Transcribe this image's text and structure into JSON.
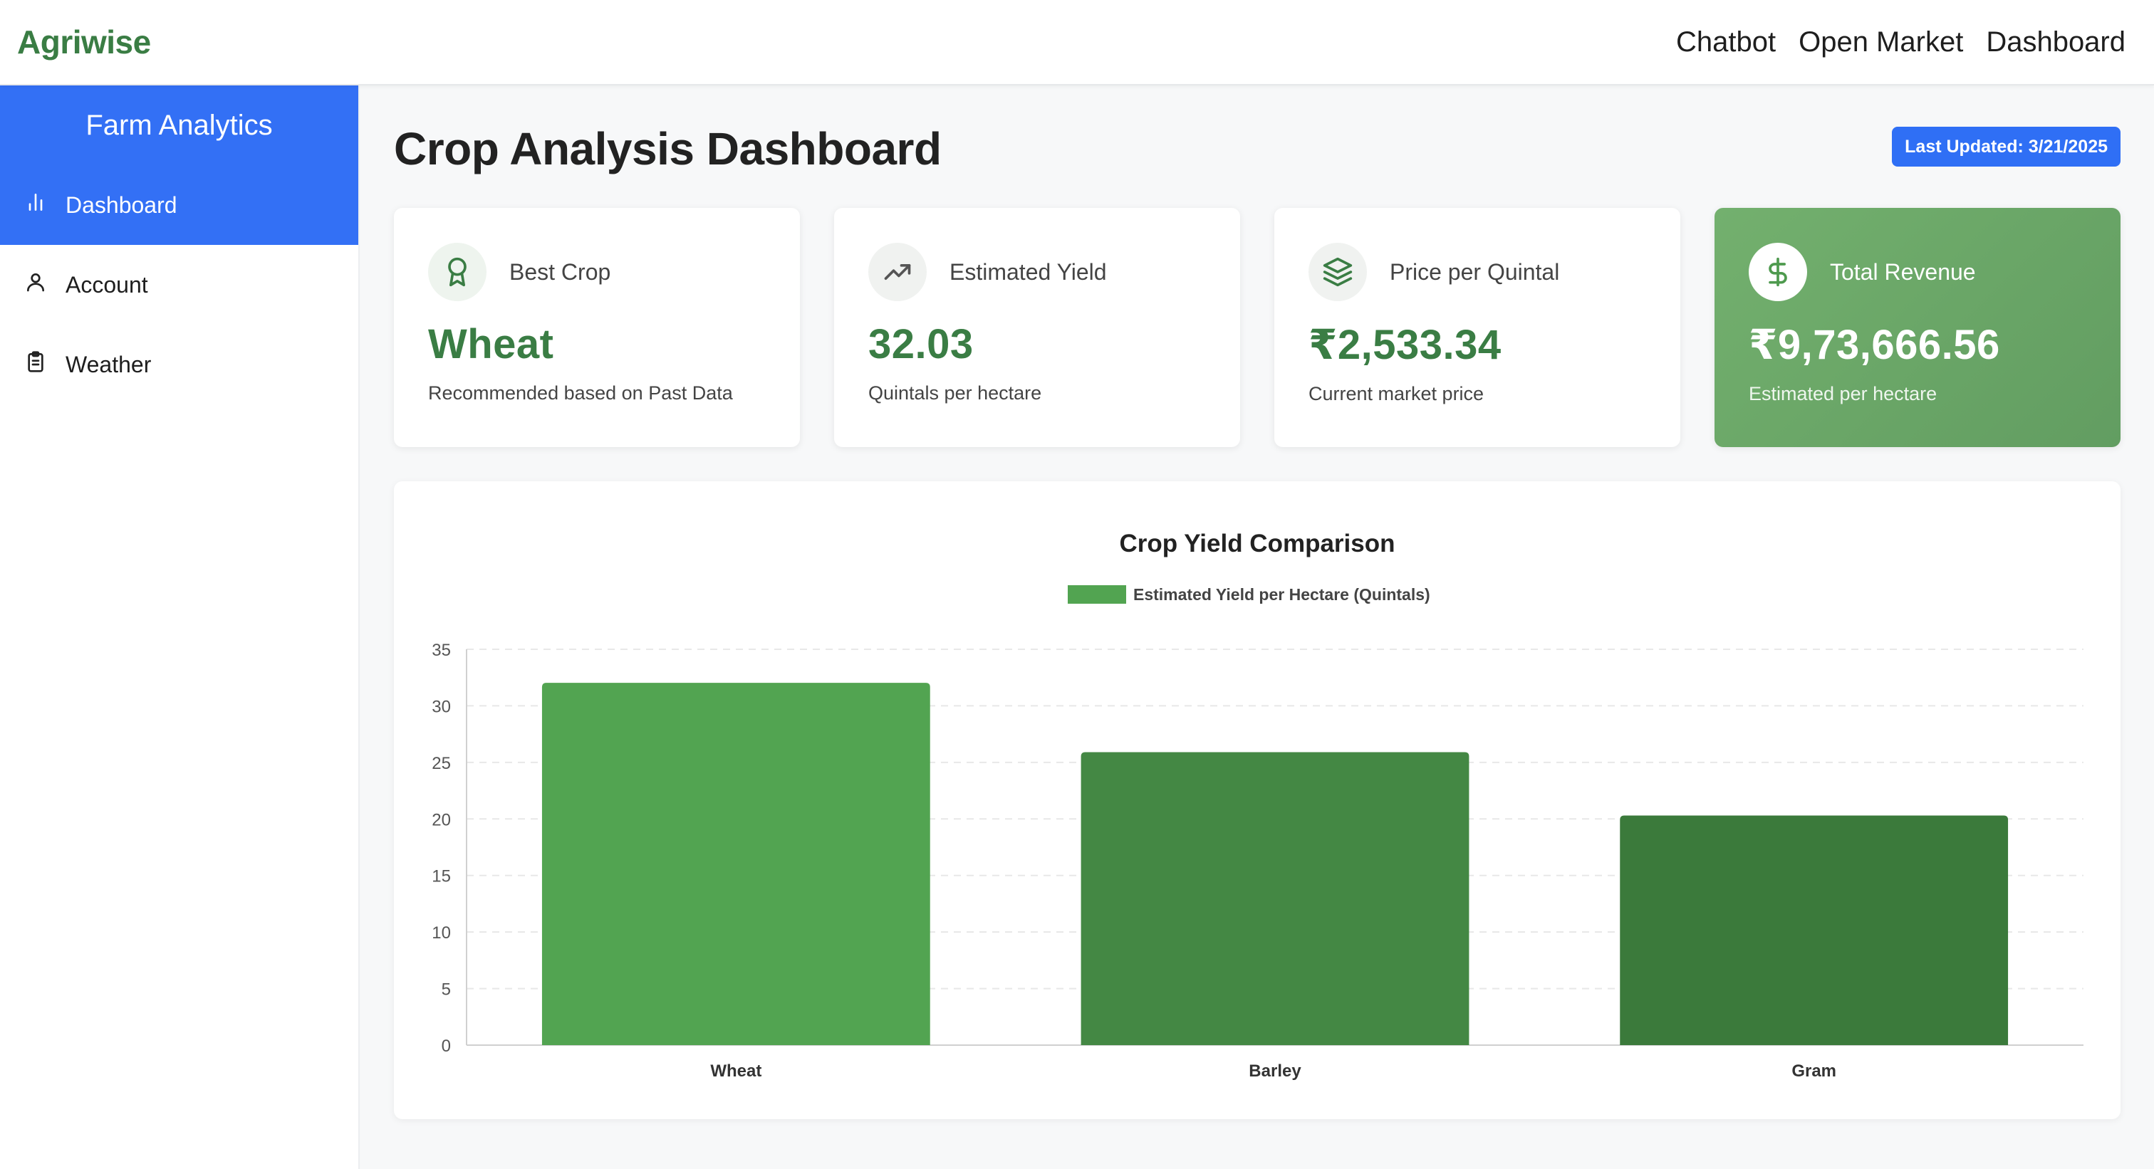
{
  "app": {
    "brand": "Agriwise",
    "nav": [
      "Chatbot",
      "Open Market",
      "Dashboard"
    ]
  },
  "sidebar": {
    "title": "Farm Analytics",
    "items": [
      {
        "label": "Dashboard",
        "icon": "bar-chart-icon",
        "active": true
      },
      {
        "label": "Account",
        "icon": "user-icon",
        "active": false
      },
      {
        "label": "Weather",
        "icon": "clipboard-icon",
        "active": false
      }
    ]
  },
  "main": {
    "title": "Crop Analysis Dashboard",
    "last_updated": "Last Updated: 3/21/2025"
  },
  "cards": [
    {
      "label": "Best Crop",
      "value": "Wheat",
      "sub": "Recommended based on Past Data",
      "icon": "award-icon"
    },
    {
      "label": "Estimated Yield",
      "value": "32.03",
      "sub": "Quintals per hectare",
      "icon": "trending-up-icon"
    },
    {
      "label": "Price per Quintal",
      "value": "₹2,533.34",
      "sub": "Current market price",
      "icon": "layers-icon"
    },
    {
      "label": "Total Revenue",
      "value": "₹9,73,666.56",
      "sub": "Estimated per hectare",
      "icon": "dollar-icon"
    }
  ],
  "colors": {
    "accent_blue": "#3370f5",
    "brand_green": "#3a7d44",
    "bar_colors": [
      "#52a451",
      "#448844",
      "#3b7a3b"
    ]
  },
  "chart_data": {
    "type": "bar",
    "title": "Crop Yield Comparison",
    "categories": [
      "Wheat",
      "Barley",
      "Gram"
    ],
    "series": [
      {
        "name": "Estimated Yield per Hectare (Quintals)",
        "values": [
          32.03,
          25.9,
          20.3
        ]
      }
    ],
    "ylim": [
      0,
      35
    ],
    "yticks": [
      0,
      5,
      10,
      15,
      20,
      25,
      30,
      35
    ],
    "grid": true,
    "legend": "top"
  }
}
